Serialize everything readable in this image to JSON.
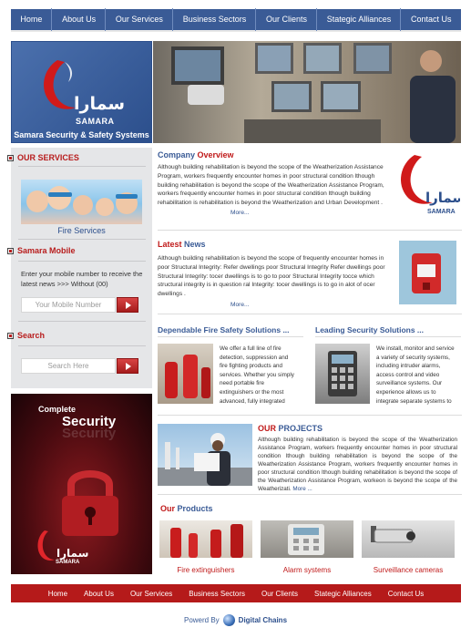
{
  "nav": {
    "items": [
      "Home",
      "About Us",
      "Our Services",
      "Business Sectors",
      "Our Clients",
      "Stategic Alliances",
      "Contact Us"
    ]
  },
  "brand": {
    "arabic": "سمارا",
    "latin": "SAMARA",
    "tagline": "Samara Security & Safety Systems"
  },
  "sidebar": {
    "services_title": "OUR SERVICES",
    "fire_label": "Fire Services",
    "mobile_title": "Samara Mobile",
    "mobile_text": "Enter your mobile number to receive the latest news >>> Without (00)",
    "mobile_placeholder": "Your Mobile Number",
    "search_title": "Search",
    "search_placeholder": "Search Here"
  },
  "promo": {
    "line1": "Complete",
    "line2": "Security",
    "line2_shadow": "Security",
    "arabic": "سمارا",
    "latin": "SAMARA"
  },
  "overview": {
    "title_a": "Company ",
    "title_b": "Overview",
    "text": "Although building rehabilitation is beyond the scope of the Weatherization Assistance Program, workers frequently encounter homes in poor structural condition lthough building rehabilitation is beyond the scope of the Weatherization Assistance Program, workers frequently encounter homes in poor structural condition lthough building rehabilitation is rehabilitation is beyond the Weatherization and Urban Development .",
    "more": "More..."
  },
  "news": {
    "title_a": "Latest ",
    "title_b": "News",
    "text": "Although building rehabilitation is beyond the scope of frequently encounter homes in poor Structural Integrity: Refer dwellings poor Structural Integrity Refer dwellings poor Structural Integrity: tocer dwellings is to go to poor Structural Integrity tocce which structural integrity is in question ral Integrity: tocer dwellings is to go in alot of ocer dwellings .",
    "more": "More..."
  },
  "fire_card": {
    "title": "Dependable Fire Safety Solutions ...",
    "text": "We offer a full line of fire detection, suppression and fire fighting products and services. Whether you simply need portable fire extinguishers or the most advanced, fully integrated"
  },
  "security_card": {
    "title": "Leading Security Solutions ...",
    "text": "We install, monitor and service a variety of security systems, including intruder alarms, access control and video surveillance systems. Our experience allows us to integrate separate systems to"
  },
  "projects": {
    "title_a": "OUR ",
    "title_b": "PROJECTS",
    "text": "Although building rehabilitation is beyond the scope of the Weatherization Assistance Program, workers frequently encounter homes in poor structural condition lthough building rehabilitation is beyond the scope of the Weatherization Assistance Program, workers frequently encounter homes in poor structural condition lthough building rehabilitation is beyond the scope of the Weatherization Assistance Program, workeon is beyond the scope of the Weatherizati.",
    "more": "More ..."
  },
  "products": {
    "title_a": "Our ",
    "title_b": "Products",
    "items": [
      "Fire extinguishers",
      "Alarm systems",
      "Surveillance cameras"
    ]
  },
  "footer_nav": {
    "items": [
      "Home",
      "About Us",
      "Our Services",
      "Business Sectors",
      "Our Clients",
      "Stategic Alliances",
      "Contact Us"
    ]
  },
  "powered": {
    "label": "Powerd By",
    "brand": "Digital Chains"
  },
  "colors": {
    "nav_blue": "#3a5b96",
    "accent_red": "#c01a1a",
    "footer_red": "#b51a1a"
  }
}
